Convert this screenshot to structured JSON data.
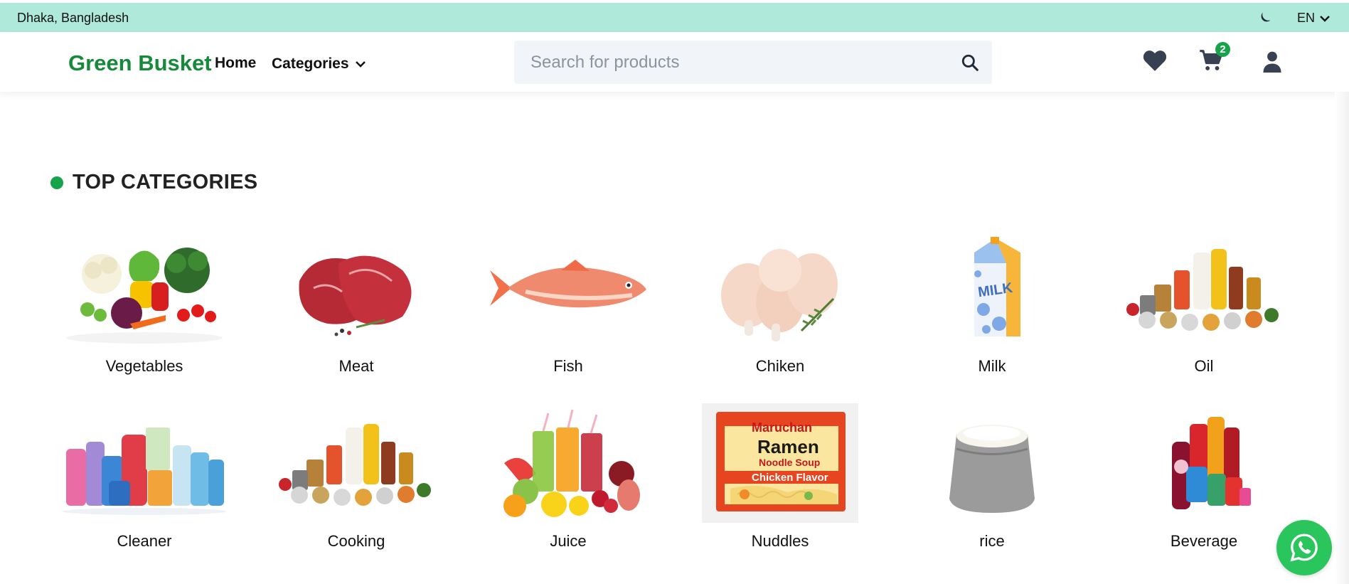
{
  "topbar": {
    "location": "Dhaka, Bangladesh",
    "language": "EN"
  },
  "header": {
    "brand": "Green Busket",
    "nav": {
      "home": "Home",
      "categories": "Categories"
    },
    "search": {
      "placeholder": "Search for products",
      "value": ""
    },
    "cart_count": "2"
  },
  "section": {
    "title": "TOP CATEGORIES"
  },
  "categories": [
    {
      "label": "Vegetables"
    },
    {
      "label": "Meat"
    },
    {
      "label": "Fish"
    },
    {
      "label": "Chiken"
    },
    {
      "label": "Milk"
    },
    {
      "label": "Oil"
    },
    {
      "label": "Cleaner"
    },
    {
      "label": "Cooking"
    },
    {
      "label": "Juice"
    },
    {
      "label": "Nuddles"
    },
    {
      "label": "rice"
    },
    {
      "label": "Beverage"
    }
  ],
  "noodle_pack": {
    "brand": "Maruchan",
    "name": "Ramen",
    "sub": "Noodle Soup",
    "flavor": "Chicken Flavor"
  },
  "milk_carton": {
    "text": "MILK"
  },
  "colors": {
    "brand_green": "#168a3a",
    "accent_green": "#16a34a",
    "topbar_bg": "#aee9d9",
    "whatsapp": "#2bc55e"
  },
  "icons": [
    "moon-icon",
    "chevron-down-icon",
    "search-icon",
    "heart-icon",
    "cart-icon",
    "user-icon",
    "whatsapp-icon"
  ]
}
